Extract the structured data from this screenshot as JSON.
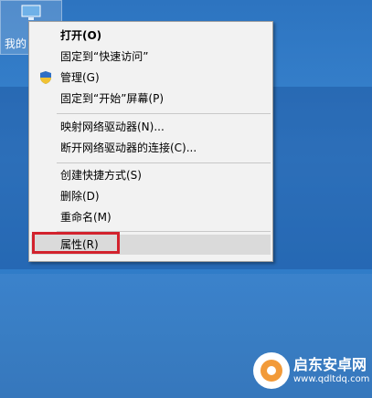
{
  "desktop": {
    "icon_label": "我的",
    "icon_name": "this-pc-icon"
  },
  "context_menu": {
    "items": [
      {
        "label": "打开(O)",
        "bold": true
      },
      {
        "label": "固定到“快速访问”"
      },
      {
        "label": "管理(G)",
        "icon": "shield-icon"
      },
      {
        "label": "固定到“开始”屏幕(P)"
      },
      {
        "label": "映射网络驱动器(N)..."
      },
      {
        "label": "断开网络驱动器的连接(C)..."
      },
      {
        "label": "创建快捷方式(S)"
      },
      {
        "label": "删除(D)"
      },
      {
        "label": "重命名(M)"
      },
      {
        "label": "属性(R)",
        "highlighted": true
      }
    ]
  },
  "annotation": {
    "color": "#d2222d"
  },
  "watermark": {
    "name": "启东安卓网",
    "url": "www.qdltdq.com"
  },
  "colors": {
    "menu_background": "#f2f2f2",
    "desktop_blue": "#2f78c4",
    "hover_gray": "#dadada"
  }
}
